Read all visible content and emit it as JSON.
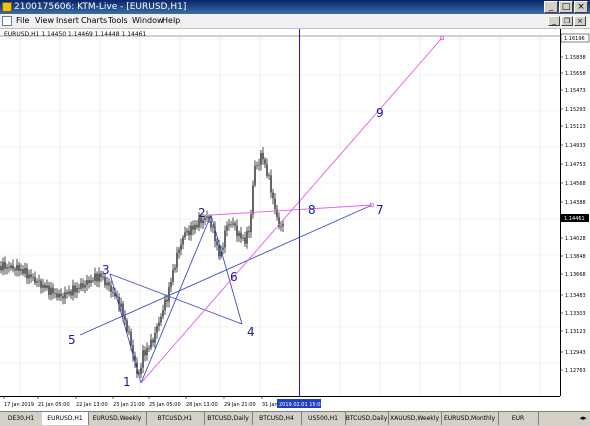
{
  "window": {
    "title": "2100175606: KTM-Live - [EURUSD,H1]",
    "minimize": "_",
    "maximize": "□",
    "close": "×"
  },
  "menu": {
    "items": [
      "File",
      "View",
      "Insert",
      "Charts",
      "Tools",
      "Window",
      "Help"
    ],
    "doc_minimize": "_",
    "doc_restore": "❐",
    "doc_close": "×"
  },
  "chart": {
    "header": "EURUSD,H1  1.14450 1.14469 1.14448 1.14461",
    "current_price": "1.14461",
    "top_price": "1.16196",
    "price_labels": [
      "1.16018",
      "1.15838",
      "1.15658",
      "1.15473",
      "1.15293",
      "1.15113",
      "1.14933",
      "1.14753",
      "1.14568",
      "1.14388",
      "1.14208",
      "1.14028",
      "1.13848",
      "1.13668",
      "1.13483",
      "1.13303",
      "1.13123",
      "1.12943",
      "1.12763"
    ],
    "time_labels": [
      "17 Jan 2019",
      "21 Jan 05:00",
      "22 Jan 13:00",
      "23 Jan 21:00",
      "25 Jan 05:00",
      "28 Jan 13:00",
      "29 Jan 21:00",
      "31 Jan"
    ],
    "crosshair_time": "2019.02.01 15:00",
    "point_labels": [
      "1",
      "2",
      "3",
      "4",
      "5",
      "6",
      "7",
      "8",
      "9"
    ],
    "colors": {
      "grid": "#e8e8e8",
      "candles": "#000000",
      "blue_lines": "#3c4cc8",
      "magenta_lines": "#e060e0",
      "crosshair": "#0000e0",
      "labels": "#1a1aa0"
    }
  },
  "tabs": {
    "items": [
      "DE30,H1",
      "EURUSD,H1",
      "EURUSD,Weekly",
      "BTCUSD,H1",
      "BTCUSD,Daily",
      "BTCUSD,H4",
      "US500,H1",
      "BTCUSD,Daily",
      "XAUUSD,Weekly",
      "EURUSD,Monthly",
      "EUR"
    ],
    "active_index": 1,
    "arrows": "◂▸"
  }
}
